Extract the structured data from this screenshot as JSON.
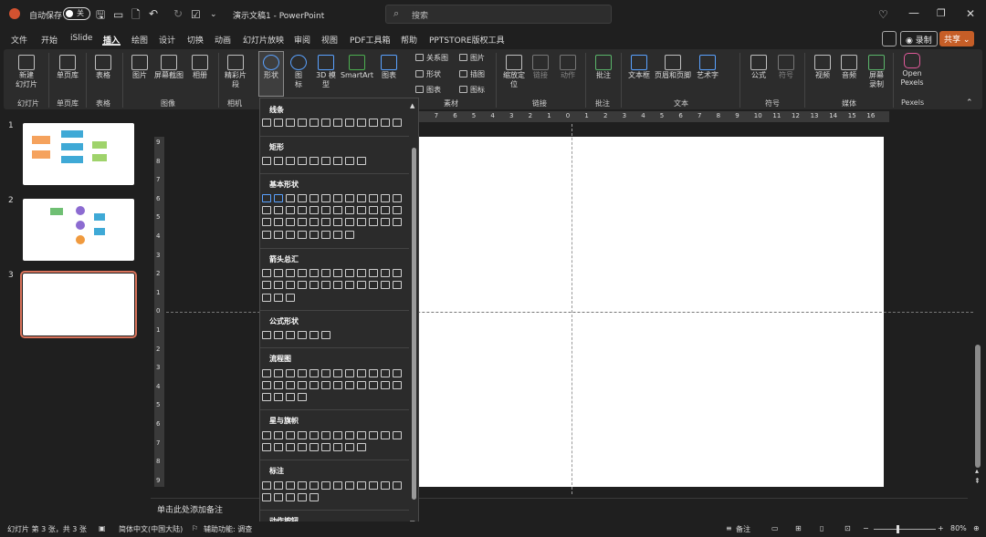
{
  "titlebar": {
    "autosave": "自动保存",
    "toggle": "关",
    "doc_title": "演示文稿1 - PowerPoint",
    "search_placeholder": "搜索"
  },
  "menu": {
    "items": [
      "文件",
      "开始",
      "iSlide",
      "插入",
      "绘图",
      "设计",
      "切换",
      "动画",
      "幻灯片放映",
      "审阅",
      "视图",
      "PDF工具箱",
      "帮助",
      "PPTSTORE版权工具"
    ],
    "active": "插入",
    "record": "录制",
    "share": "共享"
  },
  "ribbon": {
    "new_slide": "新建\n幻灯片",
    "single_page": "单页库",
    "table": "表格",
    "picture": "图片",
    "screenshot": "屏幕截图",
    "album": "相册",
    "slice": "精彩片\n段",
    "shapes": "形状",
    "icons": "图\n标",
    "model3d": "3D 模\n型",
    "smartart": "SmartArt",
    "chart": "图表",
    "relation": "关系图",
    "shape2": "形状",
    "icon2": "图表",
    "image2": "图片",
    "illus": "插图",
    "icon3": "图标",
    "zoom": "缩放定\n位",
    "link": "链接",
    "action": "动作",
    "comment": "批注",
    "textbox": "文本框",
    "header_footer": "页眉和页脚",
    "wordart": "艺术字",
    "equation": "公式",
    "symbol": "符号",
    "video": "视频",
    "audio": "音频",
    "screen_rec": "屏幕\n录制",
    "pexels": "Open\nPexels",
    "groups": {
      "slides": "幻灯片",
      "single": "单页库",
      "table": "表格",
      "image": "图像",
      "camera": "相机",
      "material": "素材",
      "link": "链接",
      "comment": "批注",
      "text": "文本",
      "symbol": "符号",
      "media": "媒体",
      "pexels": "Pexels"
    }
  },
  "slides": [
    {
      "num": "1"
    },
    {
      "num": "2"
    },
    {
      "num": "3"
    }
  ],
  "ruler": {
    "h": [
      "8",
      "7",
      "6",
      "5",
      "4",
      "3",
      "2",
      "1",
      "0",
      "1",
      "2",
      "3",
      "4",
      "5",
      "6",
      "7",
      "8",
      "9",
      "10",
      "11",
      "12",
      "13",
      "14",
      "15",
      "16"
    ],
    "v": [
      "9",
      "8",
      "7",
      "6",
      "5",
      "4",
      "3",
      "2",
      "1",
      "0",
      "1",
      "2",
      "3",
      "4",
      "5",
      "6",
      "7",
      "8",
      "9"
    ]
  },
  "notes": {
    "placeholder": "单击此处添加备注"
  },
  "shapes_menu": {
    "sections": [
      "线条",
      "矩形",
      "基本形状",
      "箭头总汇",
      "公式形状",
      "流程图",
      "星与旗帜",
      "标注",
      "动作按钮"
    ]
  },
  "status": {
    "slide_info": "幻灯片 第 3 张，共 3 张",
    "language": "简体中文(中国大陆)",
    "accessibility": "辅助功能: 调查",
    "notes_btn": "备注",
    "zoom": "80%"
  },
  "colors": {
    "accent": "#d35230",
    "share": "#c65e27"
  }
}
